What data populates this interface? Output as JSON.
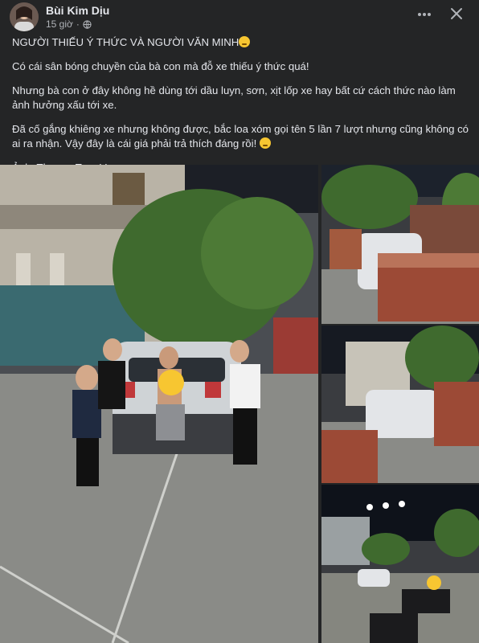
{
  "post": {
    "author": "Bùi Kim Dịu",
    "time": "15 giờ",
    "privacy_icon": "globe-icon",
    "more_icon": "more-options-icon",
    "close_icon": "close-icon",
    "title": "NGƯỜI THIẾU Ý THỨC VÀ NGƯỜI VĂN MINH",
    "para1": "Có cái sân bóng chuyền của bà con mà đỗ xe thiếu ý thức quá!",
    "para2": "Nhưng bà con ở đây không hề dùng tới dầu luyn, sơn, xịt lốp xe hay bất cứ cách thức nào làm ảnh hưởng xấu tới xe.",
    "para3": "Đã cố gắng khiêng xe nhưng không được, bắc loa xóm gọi tên 5 lần 7 lượt nhưng cũng không có ai ra nhận. Vậy đây là cái giá phải trả thích đáng rồi!",
    "credit": "Ảnh: Thuong Tran Van"
  },
  "colors": {
    "background": "#242526",
    "text_primary": "#e4e6eb",
    "text_secondary": "#b0b3b8"
  }
}
